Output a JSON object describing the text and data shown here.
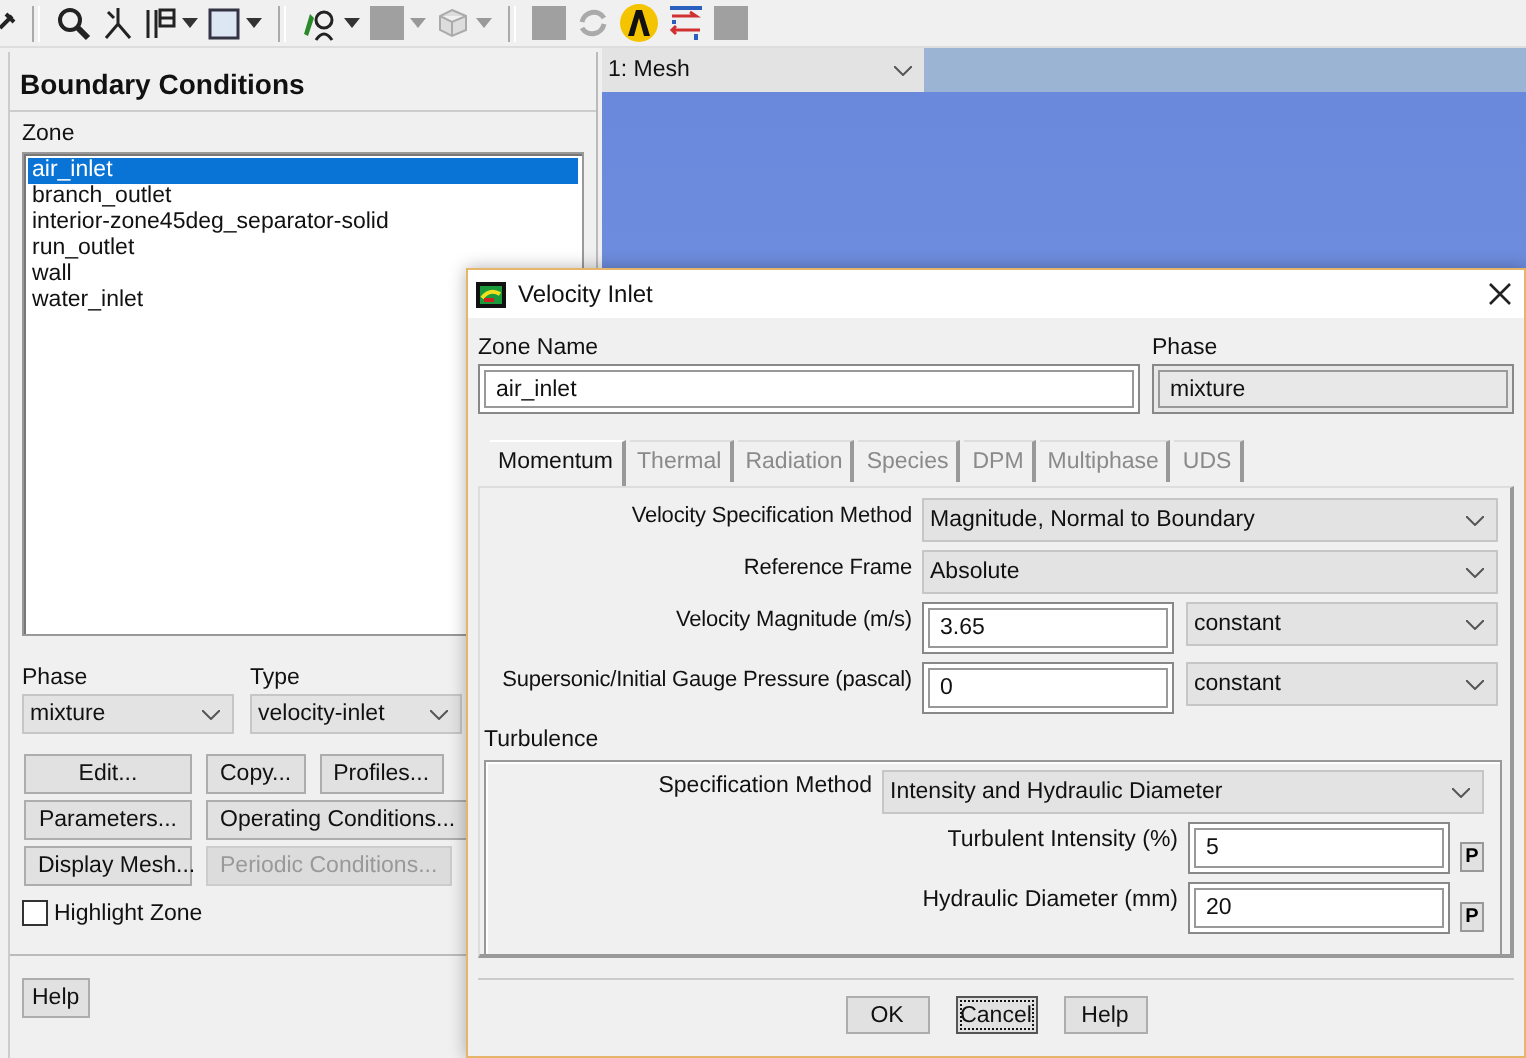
{
  "panel": {
    "title": "Boundary Conditions",
    "zone_label": "Zone",
    "zones": [
      {
        "name": "air_inlet",
        "selected": true
      },
      {
        "name": "branch_outlet",
        "selected": false
      },
      {
        "name": "interior-zone45deg_separator-solid",
        "selected": false
      },
      {
        "name": "run_outlet",
        "selected": false
      },
      {
        "name": "wall",
        "selected": false
      },
      {
        "name": "water_inlet",
        "selected": false
      }
    ],
    "phase": {
      "label": "Phase",
      "value": "mixture"
    },
    "type": {
      "label": "Type",
      "value": "velocity-inlet"
    },
    "button_rows": [
      [
        {
          "label": "Edit...",
          "disabled": false
        },
        {
          "label": "Copy...",
          "disabled": false
        },
        {
          "label": "Profiles...",
          "disabled": false
        }
      ],
      [
        {
          "label": "Parameters...",
          "disabled": false
        },
        {
          "label": "Operating Conditions...",
          "disabled": false
        }
      ],
      [
        {
          "label": "Display Mesh...",
          "disabled": false
        },
        {
          "label": "Periodic Conditions...",
          "disabled": true
        }
      ]
    ],
    "highlight_zone": {
      "label": "Highlight Zone",
      "checked": false
    },
    "help": "Help"
  },
  "graphics": {
    "view": "1: Mesh"
  },
  "dialog": {
    "title": "Velocity Inlet",
    "zone_name": {
      "label": "Zone Name",
      "value": "air_inlet",
      "editable": true
    },
    "phase": {
      "label": "Phase",
      "value": "mixture",
      "editable": false
    },
    "tabs": [
      {
        "label": "Momentum",
        "selected": true,
        "disabled": false
      },
      {
        "label": "Thermal",
        "selected": false,
        "disabled": true
      },
      {
        "label": "Radiation",
        "selected": false,
        "disabled": true
      },
      {
        "label": "Species",
        "selected": false,
        "disabled": true
      },
      {
        "label": "DPM",
        "selected": false,
        "disabled": true
      },
      {
        "label": "Multiphase",
        "selected": false,
        "disabled": true
      },
      {
        "label": "UDS",
        "selected": false,
        "disabled": true
      }
    ],
    "rows": [
      {
        "kind": "select",
        "label": "Velocity Specification Method",
        "value": "Magnitude, Normal to Boundary"
      },
      {
        "kind": "select",
        "label": "Reference Frame",
        "value": "Absolute"
      },
      {
        "kind": "input",
        "label": "Velocity Magnitude (m/s)",
        "value": "3.65",
        "method": "constant"
      },
      {
        "kind": "input",
        "label": "Supersonic/Initial Gauge Pressure (pascal)",
        "value": "0",
        "method": "constant"
      }
    ],
    "turbulence": {
      "title": "Turbulence",
      "rows": [
        {
          "kind": "select",
          "label": "Specification Method",
          "value": "Intensity and Hydraulic Diameter"
        },
        {
          "kind": "param",
          "label": "Turbulent Intensity (%)",
          "value": "5",
          "param": "P"
        },
        {
          "kind": "param",
          "label": "Hydraulic Diameter (mm)",
          "value": "20",
          "param": "P"
        }
      ]
    },
    "buttons": [
      {
        "label": "OK",
        "focused": false
      },
      {
        "label": "Cancel",
        "focused": true
      },
      {
        "label": "Help",
        "focused": false
      }
    ]
  }
}
